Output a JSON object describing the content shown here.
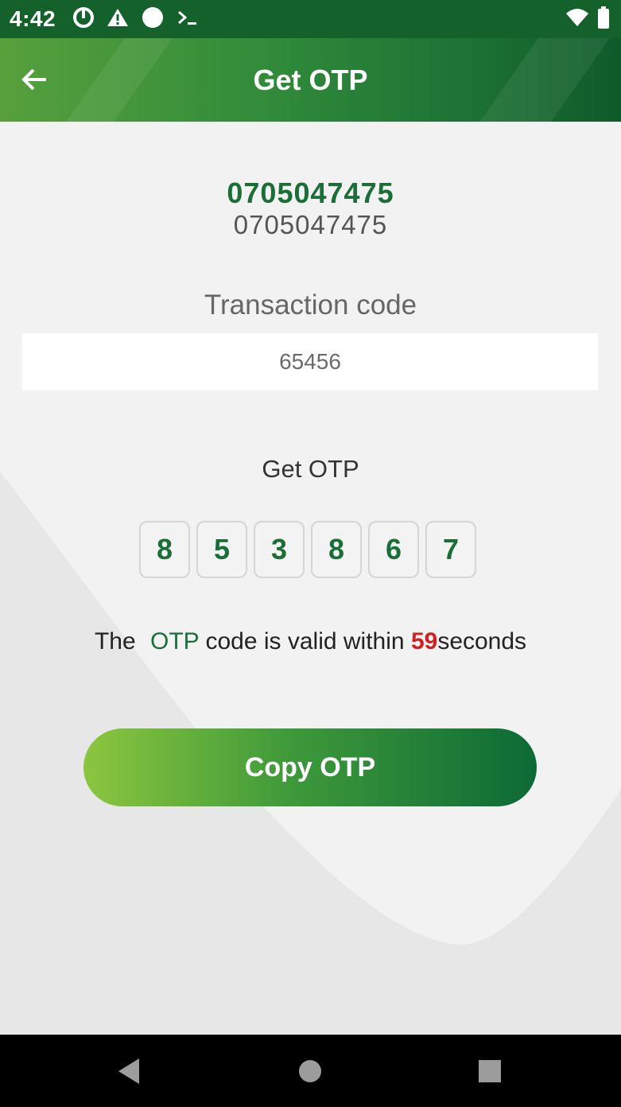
{
  "status_bar": {
    "time": "4:42",
    "left_icons": [
      "data-saver-icon",
      "warning-icon",
      "circle-icon",
      "terminal-icon"
    ],
    "right_icons": [
      "wifi-icon",
      "battery-icon"
    ]
  },
  "header": {
    "title": "Get OTP",
    "back_icon": "arrow-left-icon"
  },
  "account": {
    "primary_number": "0705047475",
    "secondary_number": "0705047475"
  },
  "transaction": {
    "label": "Transaction code",
    "value": "65456"
  },
  "otp": {
    "label": "Get OTP",
    "digits": [
      "8",
      "5",
      "3",
      "8",
      "6",
      "7"
    ],
    "validity_prefix": "The",
    "validity_otp": "OTP",
    "validity_middle": "code is valid within",
    "validity_seconds": "59",
    "validity_suffix": "seconds"
  },
  "actions": {
    "copy_label": "Copy OTP"
  },
  "colors": {
    "brand_green": "#1b6e37",
    "accent_light_green": "#8cc63f",
    "countdown_red": "#d21f1f"
  }
}
